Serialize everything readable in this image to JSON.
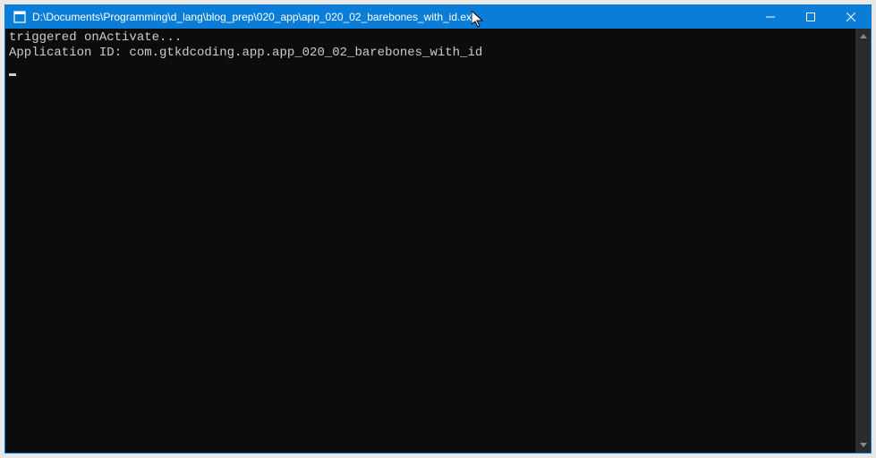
{
  "window": {
    "title": "D:\\Documents\\Programming\\d_lang\\blog_prep\\020_app\\app_020_02_barebones_with_id.exe"
  },
  "console": {
    "lines": [
      "triggered onActivate...",
      "Application ID: com.gtkdcoding.app.app_020_02_barebones_with_id"
    ]
  }
}
